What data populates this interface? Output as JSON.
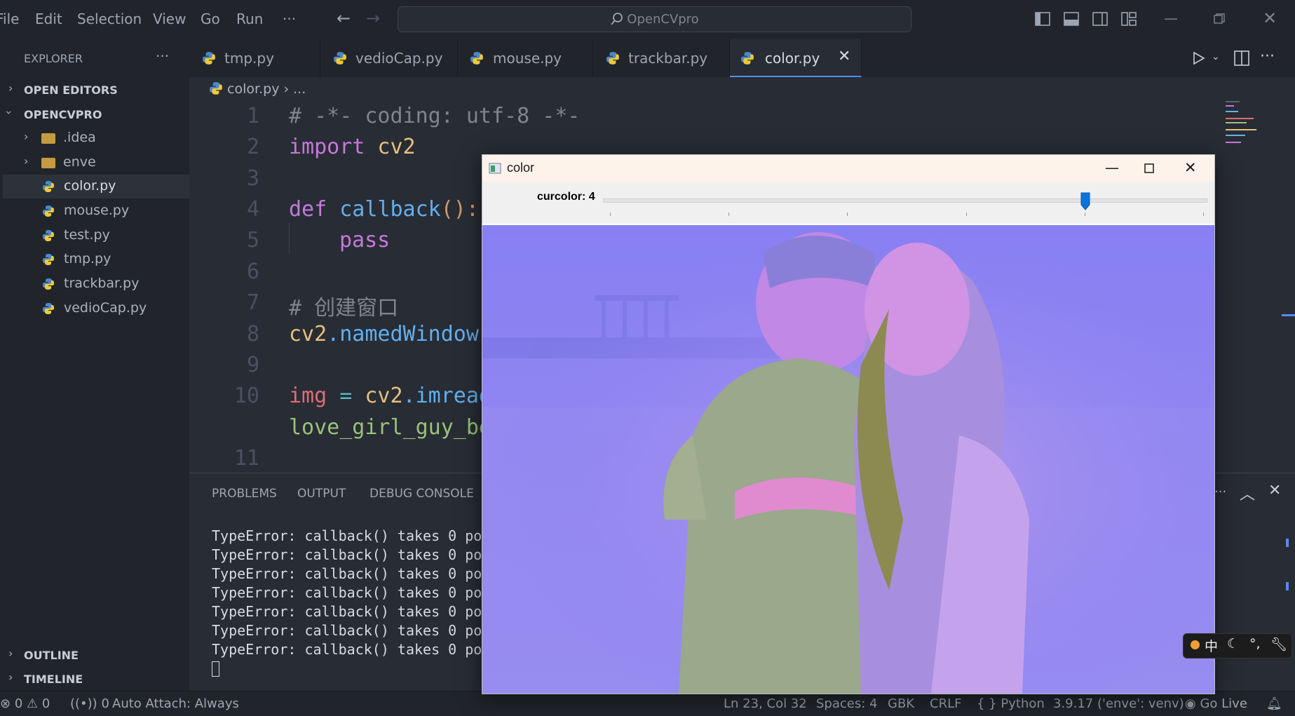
{
  "menubar": {
    "items": [
      "File",
      "Edit",
      "Selection",
      "View",
      "Go",
      "Run",
      "···"
    ],
    "search_text": "OpenCVpro"
  },
  "sidebar": {
    "title": "EXPLORER",
    "more": "···",
    "open_editors": "OPEN EDITORS",
    "project": "OPENCVPRO",
    "items": [
      {
        "label": ".idea",
        "type": "folder"
      },
      {
        "label": "enve",
        "type": "folder"
      },
      {
        "label": "color.py",
        "type": "python"
      },
      {
        "label": "mouse.py",
        "type": "python"
      },
      {
        "label": "test.py",
        "type": "python"
      },
      {
        "label": "tmp.py",
        "type": "python"
      },
      {
        "label": "trackbar.py",
        "type": "python"
      },
      {
        "label": "vedioCap.py",
        "type": "python"
      }
    ],
    "outline": "OUTLINE",
    "timeline": "TIMELINE"
  },
  "tabs": [
    "tmp.py",
    "vedioCap.py",
    "mouse.py",
    "trackbar.py",
    "color.py"
  ],
  "breadcrumb": {
    "file": "color.py",
    "rest": "..."
  },
  "editor": {
    "line_numbers": [
      "1",
      "2",
      "3",
      "4",
      "5",
      "6",
      "7",
      "8",
      "9",
      "10",
      "",
      "11"
    ],
    "lines": {
      "l1": "# -*- coding: utf-8 -*-",
      "l2_kw": "import",
      "l2_rest": " cv2",
      "l4_kw": "def",
      "l4_fn": " callback",
      "l4_rest": "():",
      "l5": "pass",
      "l7": "# 创建窗口",
      "l8_obj": "cv2",
      "l8_fn": ".namedWindow",
      "l10_var": "img",
      "l10_op": " = ",
      "l10_obj": "cv2",
      "l10_fn": ".imread",
      "l10b": "love_girl_guy_be"
    }
  },
  "panel": {
    "tabs": [
      "PROBLEMS",
      "OUTPUT",
      "DEBUG CONSOLE"
    ],
    "terminal_lines": [
      "TypeError: callback() takes 0 po",
      "TypeError: callback() takes 0 po",
      "TypeError: callback() takes 0 po",
      "TypeError: callback() takes 0 po",
      "TypeError: callback() takes 0 po",
      "TypeError: callback() takes 0 po",
      "TypeError: callback() takes 0 po"
    ]
  },
  "statusbar": {
    "errors": "0",
    "warnings": "0",
    "ports": "0",
    "auto_attach": "Auto Attach: Always",
    "position": "Ln 23, Col 32",
    "spaces": "Spaces: 4",
    "encoding": "GBK",
    "eol": "CRLF",
    "language": "Python",
    "interpreter": "3.9.17 ('enve': venv)",
    "go_live": "Go Live"
  },
  "cv_window": {
    "title": "color",
    "trackbar_label": "curcolor: 4",
    "trackbar_value": 4,
    "trackbar_max": 5
  },
  "ime": {
    "mode": "中"
  },
  "colors": {
    "accent": "#528bff",
    "image_tint": "#8a80f2"
  }
}
